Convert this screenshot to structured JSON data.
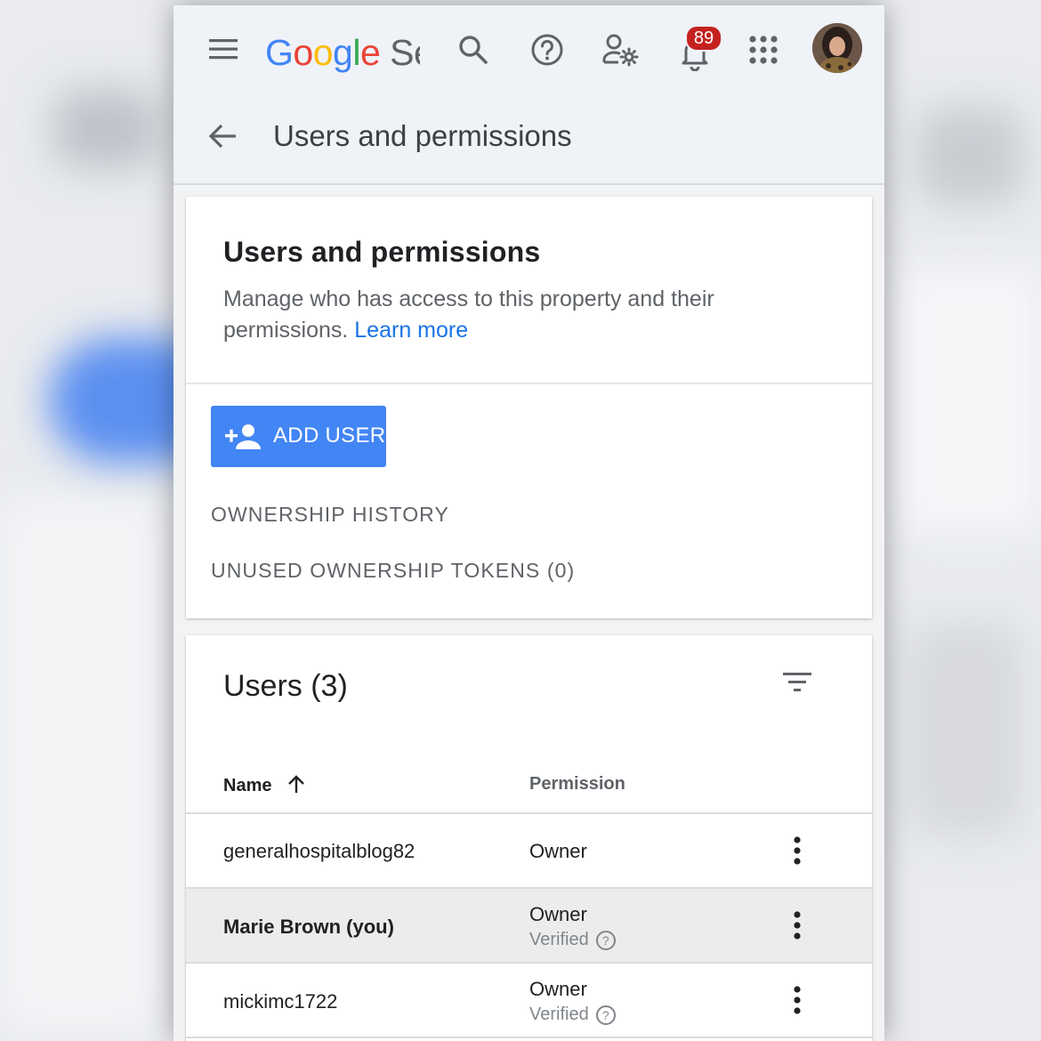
{
  "app": {
    "logo_text": "Google Se",
    "notification_count": "89"
  },
  "header": {
    "title": "Users and permissions"
  },
  "permissions_card": {
    "title": "Users and permissions",
    "description": "Manage who has access to this property and their permissions.",
    "learn_more": "Learn more",
    "add_user_label": "ADD USER",
    "ownership_history": "OWNERSHIP HISTORY",
    "unused_tokens": "UNUSED OWNERSHIP TOKENS (0)"
  },
  "users_card": {
    "title": "Users (3)",
    "columns": {
      "name": "Name",
      "permission": "Permission"
    },
    "rows": [
      {
        "name": "generalhospitalblog82",
        "permission": "Owner",
        "status": ""
      },
      {
        "name": "Marie Brown (you)",
        "permission": "Owner",
        "status": "Verified"
      },
      {
        "name": "mickimc1722",
        "permission": "Owner",
        "status": "Verified"
      }
    ]
  },
  "colors": {
    "accent": "#4285f4",
    "link": "#1a73e8",
    "badge": "#c5221f",
    "selected_row": "#ececec"
  }
}
